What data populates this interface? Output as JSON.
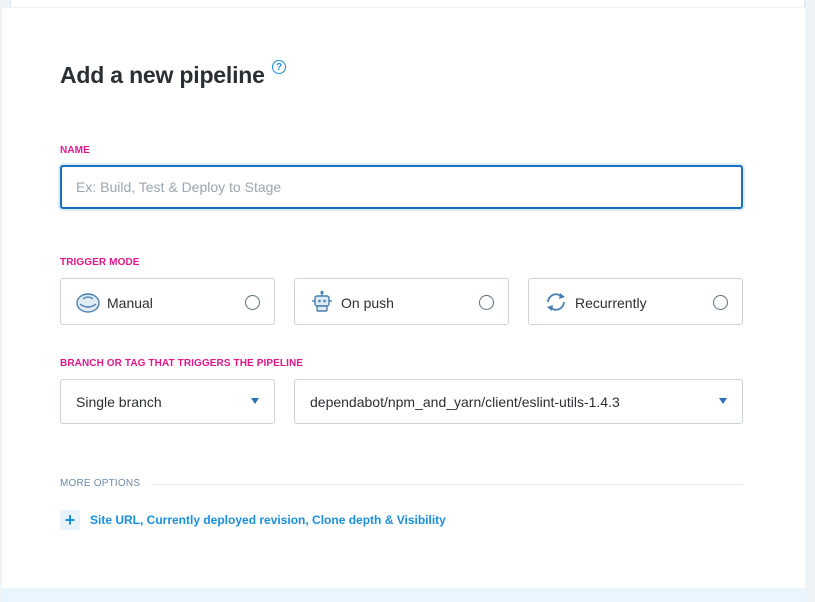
{
  "form": {
    "title": "Add a new pipeline",
    "help_icon": "?",
    "name_label": "NAME",
    "name_value": "",
    "name_placeholder": "Ex: Build, Test & Deploy to Stage",
    "trigger_label": "TRIGGER MODE",
    "trigger_options": [
      {
        "label": "Manual",
        "icon": "hand-click-icon",
        "selected": false
      },
      {
        "label": "On push",
        "icon": "robot-icon",
        "selected": false
      },
      {
        "label": "Recurrently",
        "icon": "refresh-icon",
        "selected": false
      }
    ],
    "branch_label": "BRANCH OR TAG THAT TRIGGERS THE PIPELINE",
    "branch_mode": "Single branch",
    "branch_value": "dependabot/npm_and_yarn/client/eslint-utils-1.4.3",
    "more_options_label": "MORE OPTIONS",
    "more_options_plus": "+",
    "more_options_link": "Site URL, Currently deployed revision, Clone depth & Visibility"
  },
  "colors": {
    "accent_label": "#e0188a",
    "link": "#1a8fe0",
    "input_focus_border": "#1a6fc0"
  }
}
